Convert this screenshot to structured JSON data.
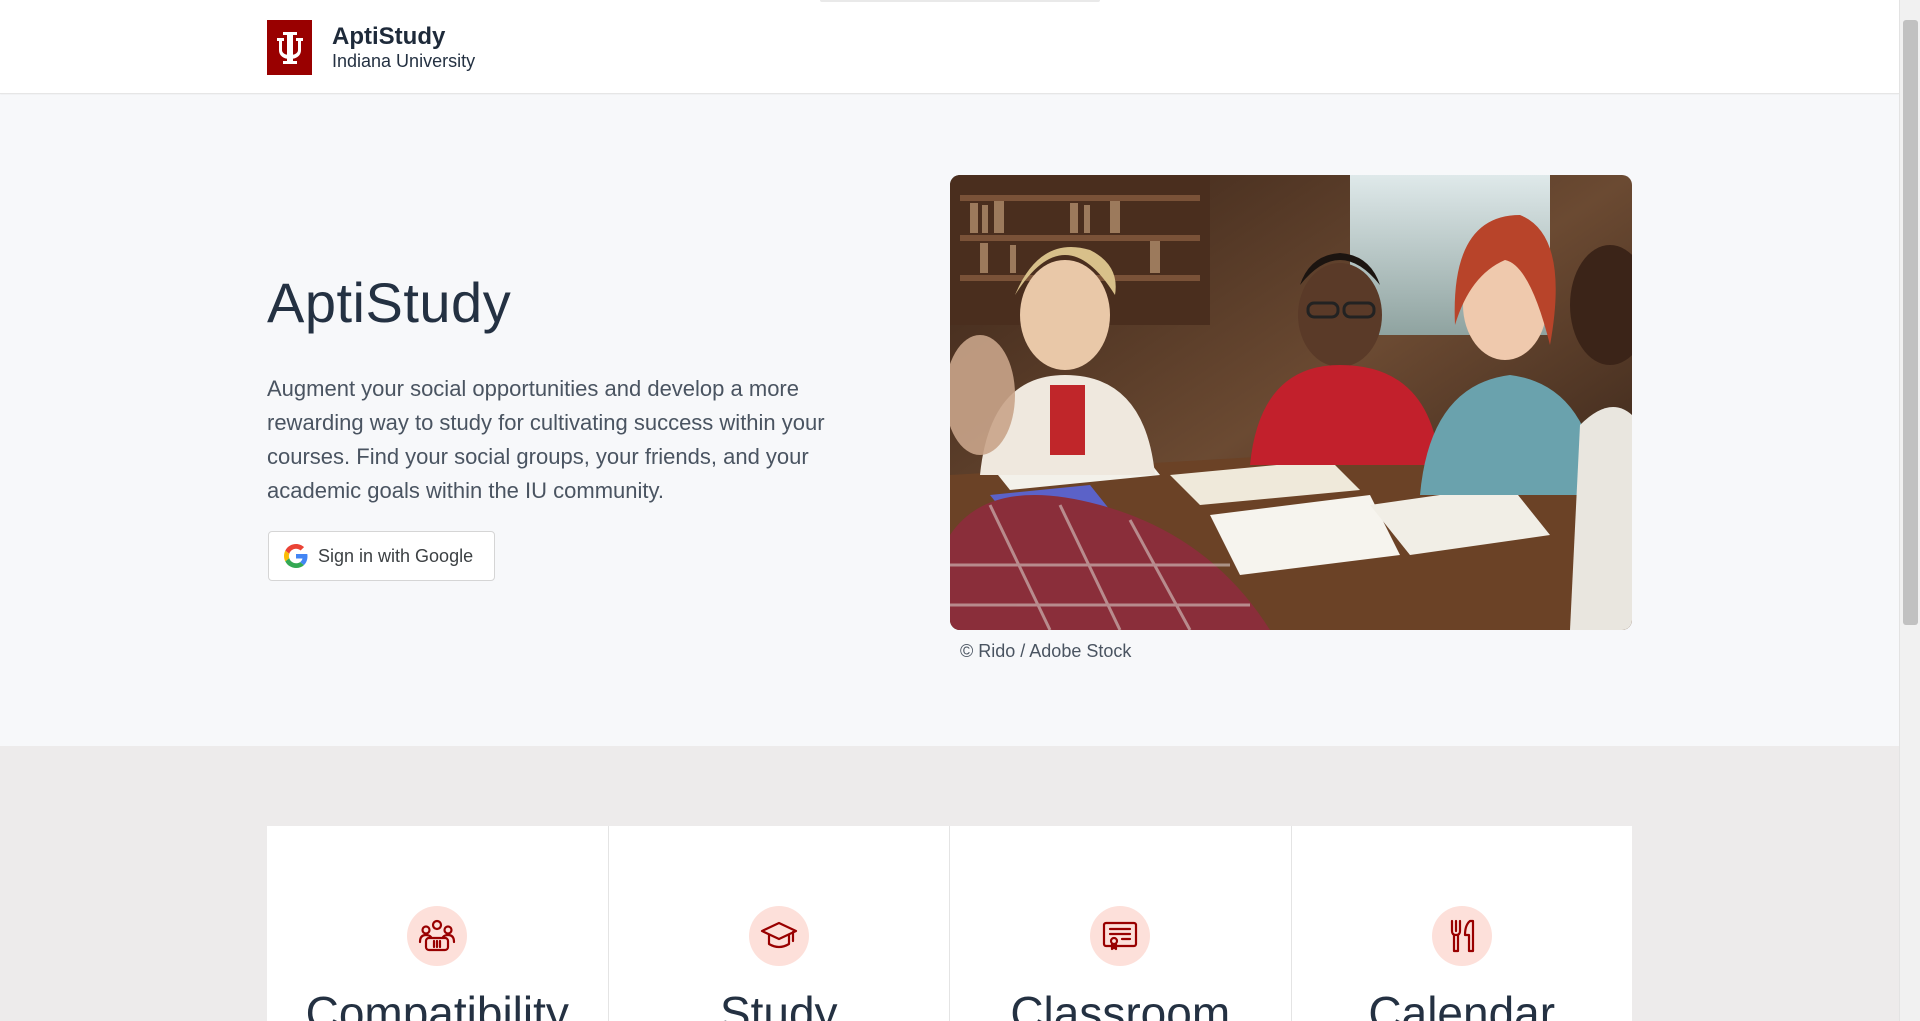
{
  "header": {
    "title": "AptiStudy",
    "subtitle": "Indiana University"
  },
  "hero": {
    "title": "AptiStudy",
    "description": "Augment your social opportunities and develop a more rewarding way to study for cultivating success within your courses. Find your social groups, your friends, and your academic goals within the IU community.",
    "signin_label": "Sign in with Google",
    "image_credit": "© Rido / Adobe Stock"
  },
  "features": [
    {
      "title": "Compatibility",
      "icon": "group-icon"
    },
    {
      "title": "Study",
      "icon": "graduation-cap-icon"
    },
    {
      "title": "Classroom",
      "icon": "certificate-icon"
    },
    {
      "title": "Calendar",
      "icon": "fork-knife-icon"
    }
  ],
  "colors": {
    "brand": "#990000",
    "icon_bg": "#fde0da",
    "text": "#243142"
  }
}
